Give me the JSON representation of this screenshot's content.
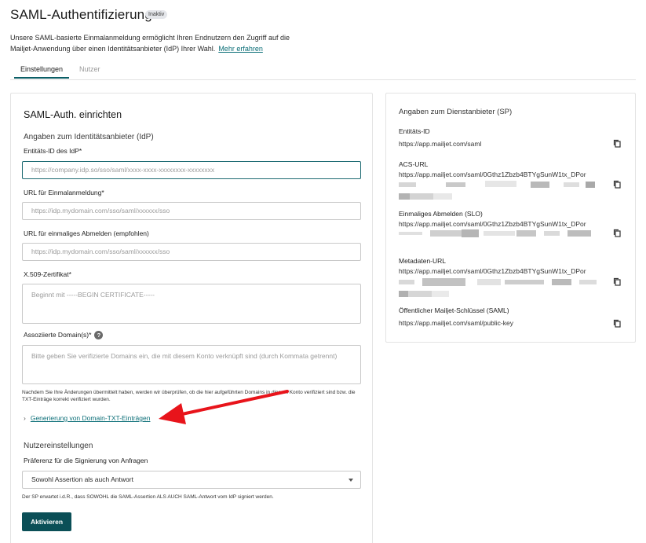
{
  "header": {
    "title": "SAML-Authentifizierung",
    "status_badge": "Inaktiv",
    "intro_text": "Unsere SAML-basierte Einmalanmeldung ermöglicht Ihren Endnutzern den Zugriff auf die Mailjet-Anwendung über einen Identitätsanbieter (IdP) Ihrer Wahl.",
    "learn_more": "Mehr erfahren"
  },
  "tabs": [
    {
      "label": "Einstellungen",
      "active": true
    },
    {
      "label": "Nutzer",
      "active": false
    }
  ],
  "setup": {
    "title": "SAML-Auth. einrichten",
    "idp_section": "Angaben zum Identitätsanbieter (IdP)",
    "fields": {
      "entity_id": {
        "label": "Entitäts-ID des IdP*",
        "placeholder": "https://company.idp.so/sso/saml/xxxx-xxxx-xxxxxxxx-xxxxxxxx"
      },
      "sso_url": {
        "label": "URL für Einmalanmeldung*",
        "placeholder": "https://idp.mydomain.com/sso/saml/xxxxxx/sso"
      },
      "slo_url": {
        "label": "URL für einmaliges Abmelden (empfohlen)",
        "placeholder": "https://idp.mydomain.com/sso/saml/xxxxxx/sso"
      },
      "certificate": {
        "label": "X.509-Zertifikat*",
        "placeholder": "Beginnt mit -----BEGIN CERTIFICATE-----"
      },
      "domains": {
        "label": "Assoziierte Domain(s)*",
        "placeholder": "Bitte geben Sie verifizierte Domains ein, die mit diesem Konto verknüpft sind (durch Kommata getrennt)"
      }
    },
    "domains_help": "Nachdem Sie Ihre Änderungen übermittelt haben, werden wir überprüfen, ob die hier aufgeführten Domains in diesem Konto verifiziert sind bzw. die TXT-Einträge korrekt verifiziert wurden.",
    "txt_link": "Generierung von Domain-TXT-Einträgen",
    "user_settings_title": "Nutzereinstellungen",
    "signing_label": "Präferenz für die Signierung von Anfragen",
    "signing_value": "Sowohl Assertion als auch Antwort",
    "signing_help": "Der SP erwartet i.d.R., dass SOWOHL die SAML-Assertion ALS AUCH SAML-Antwort vom IdP signiert werden.",
    "activate_button": "Aktivieren"
  },
  "sp": {
    "title": "Angaben zum Dienstanbieter (SP)",
    "items": [
      {
        "label": "Entitäts-ID",
        "value": "https://app.mailjet.com/saml"
      },
      {
        "label": "ACS-URL",
        "value": "https://app.mailjet.com/saml/0Gthz1Zbzb4BTYgSunW1tx_DPor"
      },
      {
        "label": "Einmaliges Abmelden (SLO)",
        "value": "https://app.mailjet.com/saml/0Gthz1Zbzb4BTYgSunW1tx_DPor"
      },
      {
        "label": "Metadaten-URL",
        "value": "https://app.mailjet.com/saml/0Gthz1Zbzb4BTYgSunW1tx_DPor"
      },
      {
        "label": "Öffentlicher Mailjet-Schlüssel (SAML)",
        "value": "https://app.mailjet.com/saml/public-key"
      }
    ]
  },
  "colors": {
    "accent": "#0b4f57",
    "annotation_arrow": "#e8141b"
  },
  "icons": [
    "help-icon",
    "chevron-right-icon",
    "caret-down-icon",
    "copy-icon",
    "annotation-arrow"
  ]
}
